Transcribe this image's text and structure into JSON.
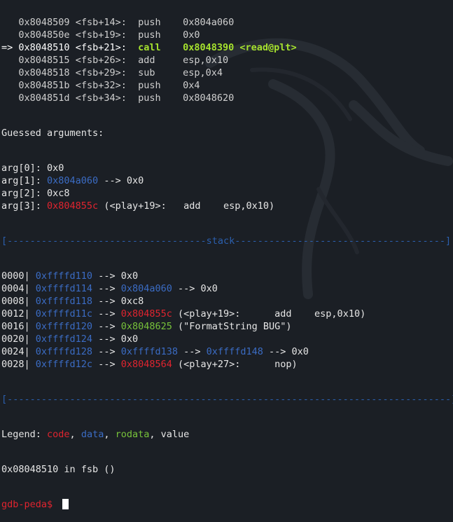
{
  "disasm": [
    {
      "arrow": "  ",
      "addr": " 0x8048509",
      "sym": "<fsb+14>:",
      "mnem": "push",
      "ops": "0x804a060"
    },
    {
      "arrow": "  ",
      "addr": " 0x804850e",
      "sym": "<fsb+19>:",
      "mnem": "push",
      "ops": "0x0"
    },
    {
      "arrow": "=>",
      "addr": " 0x8048510",
      "sym": "<fsb+21>:",
      "mnem": "call",
      "ops": "0x8048390 <read@plt>"
    },
    {
      "arrow": "  ",
      "addr": " 0x8048515",
      "sym": "<fsb+26>:",
      "mnem": "add",
      "ops": "esp,0x10"
    },
    {
      "arrow": "  ",
      "addr": " 0x8048518",
      "sym": "<fsb+29>:",
      "mnem": "sub",
      "ops": "esp,0x4"
    },
    {
      "arrow": "  ",
      "addr": " 0x804851b",
      "sym": "<fsb+32>:",
      "mnem": "push",
      "ops": "0x4"
    },
    {
      "arrow": "  ",
      "addr": " 0x804851d",
      "sym": "<fsb+34>:",
      "mnem": "push",
      "ops": "0x8048620"
    }
  ],
  "guessed_title": "Guessed arguments:",
  "args": [
    {
      "label": "arg[0]:",
      "value": "0x0",
      "value_class": "",
      "rest": ""
    },
    {
      "label": "arg[1]:",
      "value": "0x804a060",
      "value_class": "addr",
      "rest": " --> 0x0"
    },
    {
      "label": "arg[2]:",
      "value": "0xc8",
      "value_class": "",
      "rest": ""
    },
    {
      "label": "arg[3]:",
      "value": "0x804855c",
      "value_class": "code",
      "rest": " (<play+19>:   add    esp,0x10)"
    }
  ],
  "stack_sep_left": "[-----------------------------------",
  "stack_sep_word": "stack",
  "stack_sep_right": "-------------------------------------]",
  "stack": [
    {
      "off": "0000|",
      "addr": "0xffffd110",
      "arrow": "-->",
      "val": "0x0",
      "val_class": "",
      "rest": ""
    },
    {
      "off": "0004|",
      "addr": "0xffffd114",
      "arrow": "-->",
      "val": "0x804a060",
      "val_class": "addr",
      "rest": " --> 0x0"
    },
    {
      "off": "0008|",
      "addr": "0xffffd118",
      "arrow": "-->",
      "val": "0xc8",
      "val_class": "",
      "rest": ""
    },
    {
      "off": "0012|",
      "addr": "0xffffd11c",
      "arrow": "-->",
      "val": "0x804855c",
      "val_class": "code",
      "rest": " (<play+19>:      add    esp,0x10)"
    },
    {
      "off": "0016|",
      "addr": "0xffffd120",
      "arrow": "-->",
      "val": "0x8048625",
      "val_class": "rodata",
      "rest": " (\"FormatString BUG\")"
    },
    {
      "off": "0020|",
      "addr": "0xffffd124",
      "arrow": "-->",
      "val": "0x0",
      "val_class": "",
      "rest": ""
    },
    {
      "off": "0024|",
      "addr": "0xffffd128",
      "arrow": "-->",
      "val": "0xffffd138",
      "val_class": "addr",
      "rest": " --> ",
      "extra": "0xffffd148",
      "extra_class": "addr",
      "tail": " --> 0x0"
    },
    {
      "off": "0028|",
      "addr": "0xffffd12c",
      "arrow": "-->",
      "val": "0x8048564",
      "val_class": "code",
      "rest": " (<play+27>:      nop)"
    }
  ],
  "bottom_sep": "[------------------------------------------------------------------------------]",
  "legend": {
    "label": "Legend: ",
    "code": "code",
    "data": "data",
    "rodata": "rodata",
    "value": "value",
    "comma": ", "
  },
  "location": "0x08048510 in fsb ()",
  "prompt": "gdb-peda$ ",
  "colors": {
    "background": "#1b1f25",
    "code": "#e0242f",
    "data": "#3b6cc4",
    "rodata": "#77c23a",
    "call_highlight": "#a6e22e",
    "separator": "#2b5fae"
  }
}
